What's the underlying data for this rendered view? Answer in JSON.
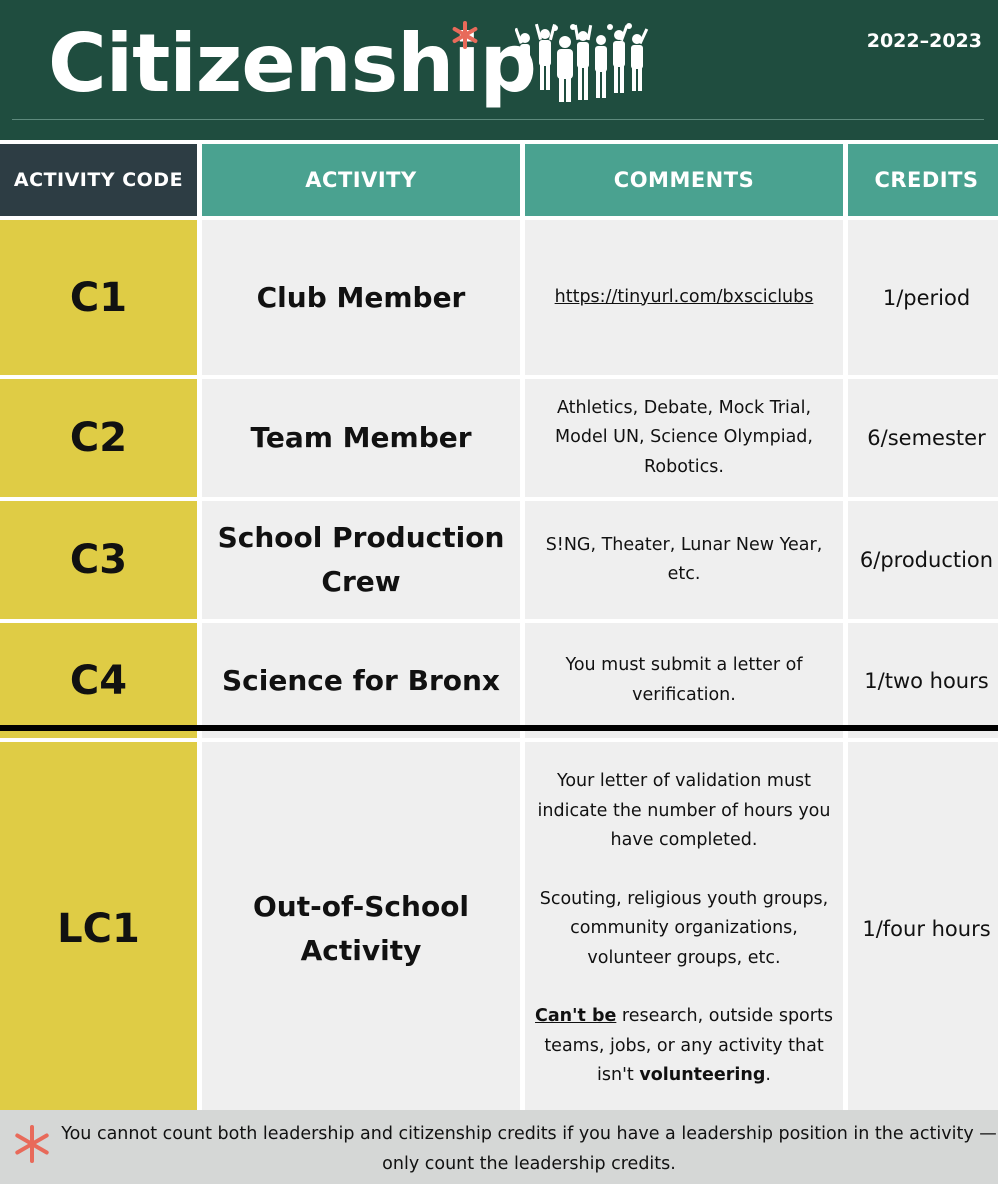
{
  "header": {
    "title": "Citizenship",
    "year": "2022–2023",
    "colors": {
      "band": "#1f4d3f",
      "star": "#e86a5a"
    },
    "icons": [
      "asterisk-icon",
      "crowd-icon"
    ]
  },
  "table": {
    "headers": {
      "code": "ACTIVITY CODE",
      "activity": "ACTIVITY",
      "comments": "COMMENTS",
      "credits": "CREDITS"
    },
    "rows": [
      {
        "code": "C1",
        "activity": "Club Member",
        "comment": "https://tinyurl.com/bxsciclubs",
        "credits": "1/period"
      },
      {
        "code": "C2",
        "activity": "Team Member",
        "comment": "Athletics, Debate, Mock Trial, Model UN, Science Olympiad, Robotics.",
        "credits": "6/semester"
      },
      {
        "code": "C3",
        "activity": "School Production Crew",
        "comment": "S!NG, Theater, Lunar New Year, etc.",
        "credits": "6/production"
      },
      {
        "code": "C4",
        "activity": "Science for Bronx",
        "comment": "You must submit a letter of verification.",
        "credits": "1/two hours"
      },
      {
        "code": "LC1",
        "activity": "Out-of-School Activity",
        "comment": {
          "para1": "Your letter of validation must indicate the number of hours you have completed.",
          "para2": "Scouting, religious youth groups, community organizations, volunteer groups, etc.",
          "para3_lead": "Can't be",
          "para3_mid": " research, outside sports teams, jobs, or any activity that isn't ",
          "para3_bold": "volunteering",
          "para3_end": "."
        },
        "credits": "1/four hours"
      }
    ],
    "colors": {
      "code_bg": "#dfcc45",
      "header_dark": "#2d3d44",
      "header_teal": "#4aa290",
      "cell_bg": "#efefef"
    }
  },
  "footer": {
    "note": "You cannot count both leadership and citizenship credits if you have a leadership position in the activity — only count the leadership credits."
  }
}
